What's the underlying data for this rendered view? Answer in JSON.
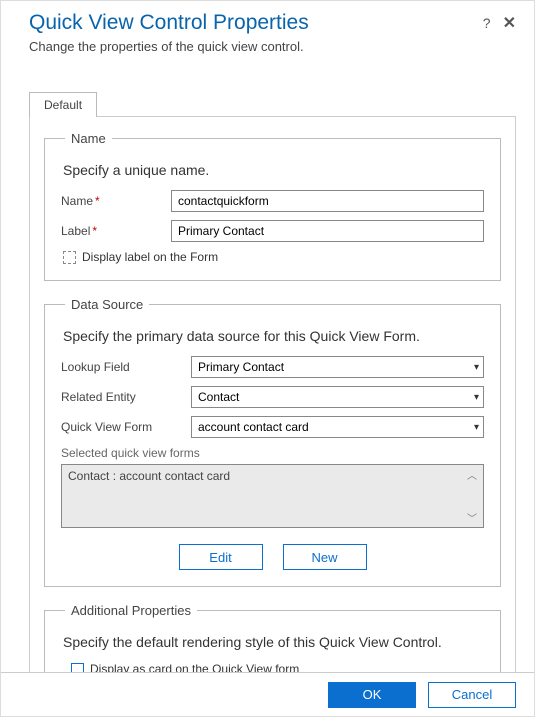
{
  "header": {
    "title": "Quick View Control Properties",
    "subtitle": "Change the properties of the quick view control."
  },
  "tabs": {
    "default": "Default"
  },
  "name_section": {
    "legend": "Name",
    "hint": "Specify a unique name.",
    "name_label": "Name",
    "name_value": "contactquickform",
    "label_label": "Label",
    "label_value": "Primary Contact",
    "display_label_text": "Display label on the Form"
  },
  "data_source": {
    "legend": "Data Source",
    "hint": "Specify the primary data source for this Quick View Form.",
    "lookup_label": "Lookup Field",
    "lookup_value": "Primary Contact",
    "related_label": "Related Entity",
    "related_value": "Contact",
    "qvf_label": "Quick View Form",
    "qvf_value": "account contact card",
    "selected_label": "Selected quick view forms",
    "selected_item": "Contact : account contact card",
    "edit_btn": "Edit",
    "new_btn": "New"
  },
  "additional": {
    "legend": "Additional Properties",
    "hint": "Specify the default rendering style of this Quick View Control.",
    "display_card_text": "Display as card on the Quick View form"
  },
  "footer": {
    "ok": "OK",
    "cancel": "Cancel"
  }
}
